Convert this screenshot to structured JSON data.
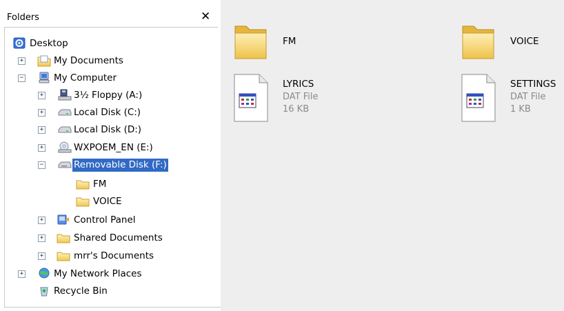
{
  "folders_pane": {
    "title": "Folders",
    "close_glyph": "✕"
  },
  "tree": {
    "desktop": "Desktop",
    "my_documents": "My Documents",
    "my_computer": "My Computer",
    "floppy": "3½ Floppy (A:)",
    "local_c": "Local Disk (C:)",
    "local_d": "Local Disk (D:)",
    "wxpoem": "WXPOEM_EN (E:)",
    "removable_f": "Removable Disk (F:)",
    "fm": "FM",
    "voice": "VOICE",
    "control_panel": "Control Panel",
    "shared_documents": "Shared Documents",
    "mrrs_documents": "mrr's Documents",
    "network_places": "My Network Places",
    "recycle_bin": "Recycle Bin",
    "expand_plus": "+",
    "expand_minus": "−"
  },
  "content": {
    "items": [
      {
        "name": "FM",
        "type": "",
        "size": ""
      },
      {
        "name": "VOICE",
        "type": "",
        "size": ""
      },
      {
        "name": "LYRICS",
        "type": "DAT File",
        "size": "16 KB"
      },
      {
        "name": "SETTINGS",
        "type": "DAT File",
        "size": "1 KB"
      }
    ]
  },
  "colors": {
    "selection": "#316ac5",
    "folder_yellow": "#f5d575",
    "content_bg": "#eeeeee"
  }
}
